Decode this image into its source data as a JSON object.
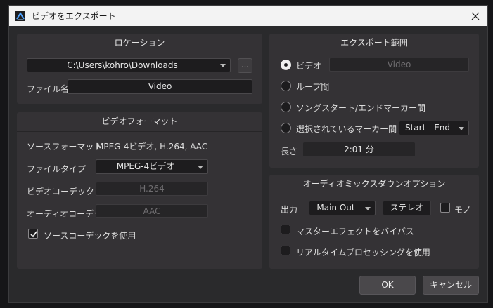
{
  "window": {
    "title": "ビデオをエクスポート"
  },
  "location": {
    "title": "ロケーション",
    "path": "C:\\Users\\kohro\\Downloads",
    "browse_label": "...",
    "filename_label": "ファイル名",
    "filename_value": "Video"
  },
  "video_format": {
    "title": "ビデオフォーマット",
    "source_format_label": "ソースフォーマット",
    "source_format_value": "MPEG-4ビデオ, H.264, AAC",
    "file_type_label": "ファイルタイプ",
    "file_type_value": "MPEG-4ビデオ",
    "video_codec_label": "ビデオコーデック",
    "video_codec_value": "H.264",
    "audio_codec_label": "オーディオコーデック",
    "audio_codec_value": "AAC",
    "use_source_codec_label": "ソースコーデックを使用",
    "use_source_codec_checked": true
  },
  "export_range": {
    "title": "エクスポート範囲",
    "options": [
      {
        "label": "ビデオ",
        "checked": true
      },
      {
        "label": "ループ間",
        "checked": false
      },
      {
        "label": "ソングスタート/エンドマーカー間",
        "checked": false
      },
      {
        "label": "選択されているマーカー間",
        "checked": false
      }
    ],
    "video_name_value": "Video",
    "marker_range_value": "Start - End",
    "length_label": "長さ",
    "length_value": "2:01 分"
  },
  "audio_mixdown": {
    "title": "オーディオミックスダウンオプション",
    "output_label": "出力",
    "output_value": "Main Out",
    "stereo_label": "ステレオ",
    "mono_label": "モノ",
    "master_effects_label": "マスターエフェクトをバイパス",
    "realtime_label": "リアルタイムプロセッシングを使用"
  },
  "buttons": {
    "ok": "OK",
    "cancel": "キャンセル"
  }
}
